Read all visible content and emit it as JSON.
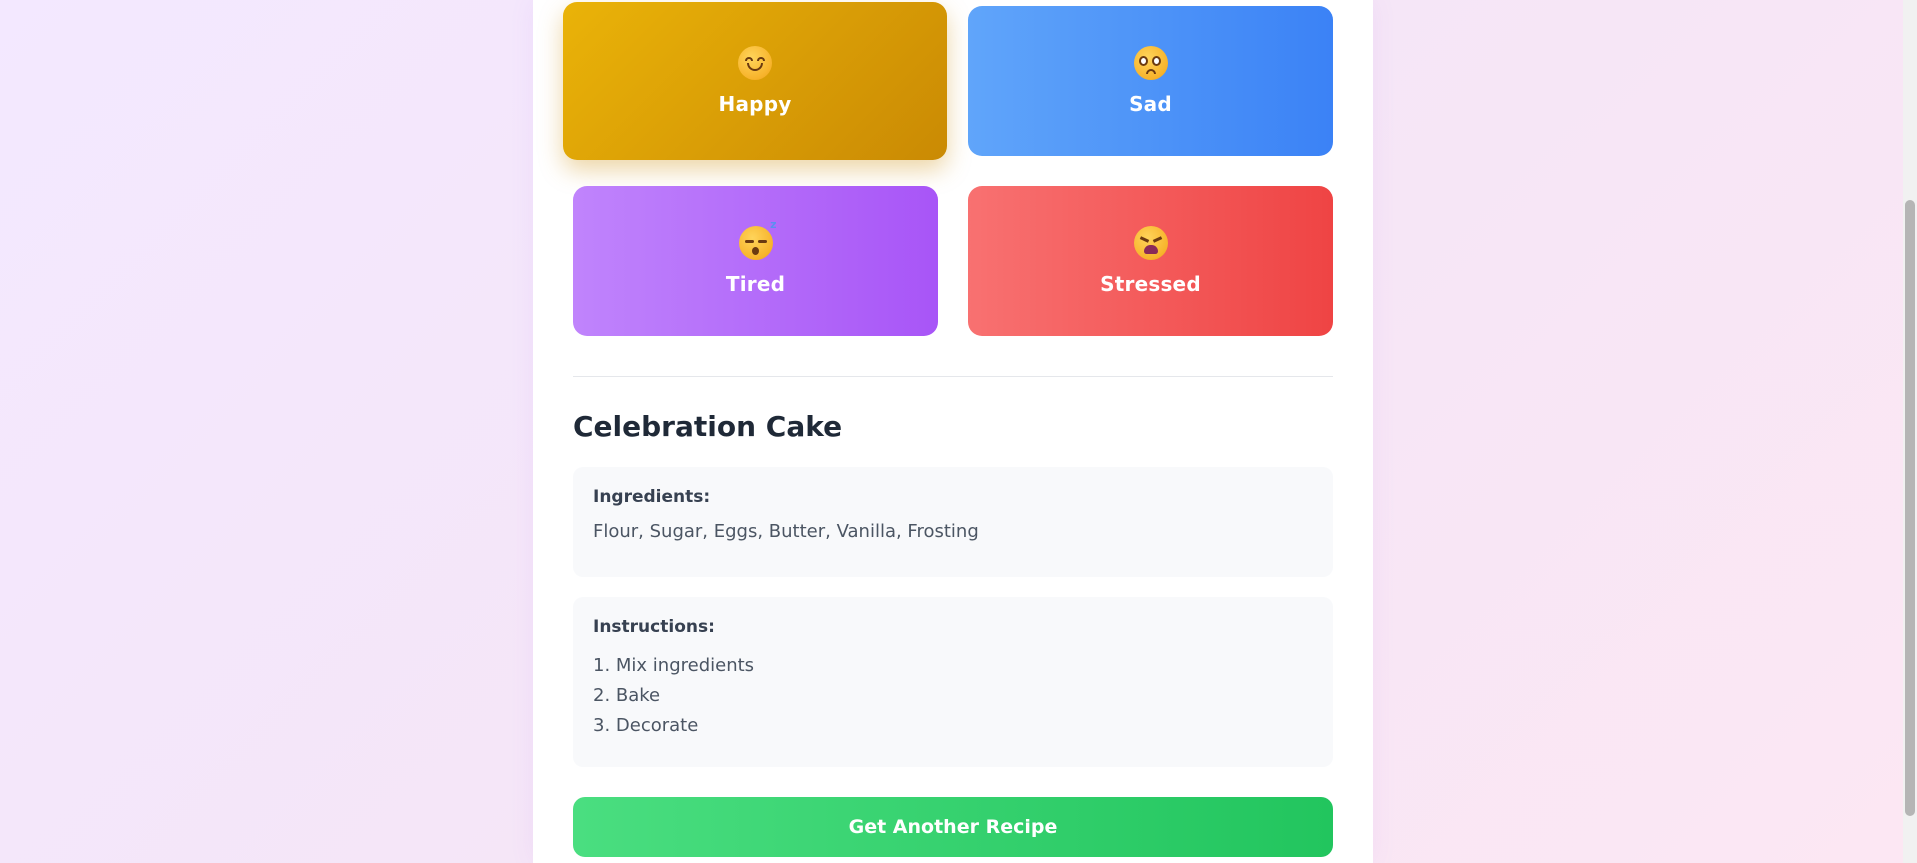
{
  "moods": [
    {
      "key": "happy",
      "label": "Happy",
      "icon": "smiling-face-icon",
      "color_from": "#eab308",
      "color_to": "#ca8a04",
      "selected": true
    },
    {
      "key": "sad",
      "label": "Sad",
      "icon": "worried-face-icon",
      "color_from": "#60a5fa",
      "color_to": "#3b82f6",
      "selected": false
    },
    {
      "key": "tired",
      "label": "Tired",
      "icon": "sleeping-face-icon",
      "color_from": "#c084fc",
      "color_to": "#a855f7",
      "selected": false
    },
    {
      "key": "stressed",
      "label": "Stressed",
      "icon": "tired-face-icon",
      "color_from": "#f87171",
      "color_to": "#ef4444",
      "selected": false
    }
  ],
  "recipe": {
    "title": "Celebration Cake",
    "ingredients_label": "Ingredients:",
    "ingredients": "Flour, Sugar, Eggs, Butter, Vanilla, Frosting",
    "instructions_label": "Instructions:",
    "steps": [
      "1. Mix ingredients",
      "2. Bake",
      "3. Decorate"
    ]
  },
  "actions": {
    "next_recipe_label": "Get Another Recipe",
    "button_color": "#22c55e"
  }
}
